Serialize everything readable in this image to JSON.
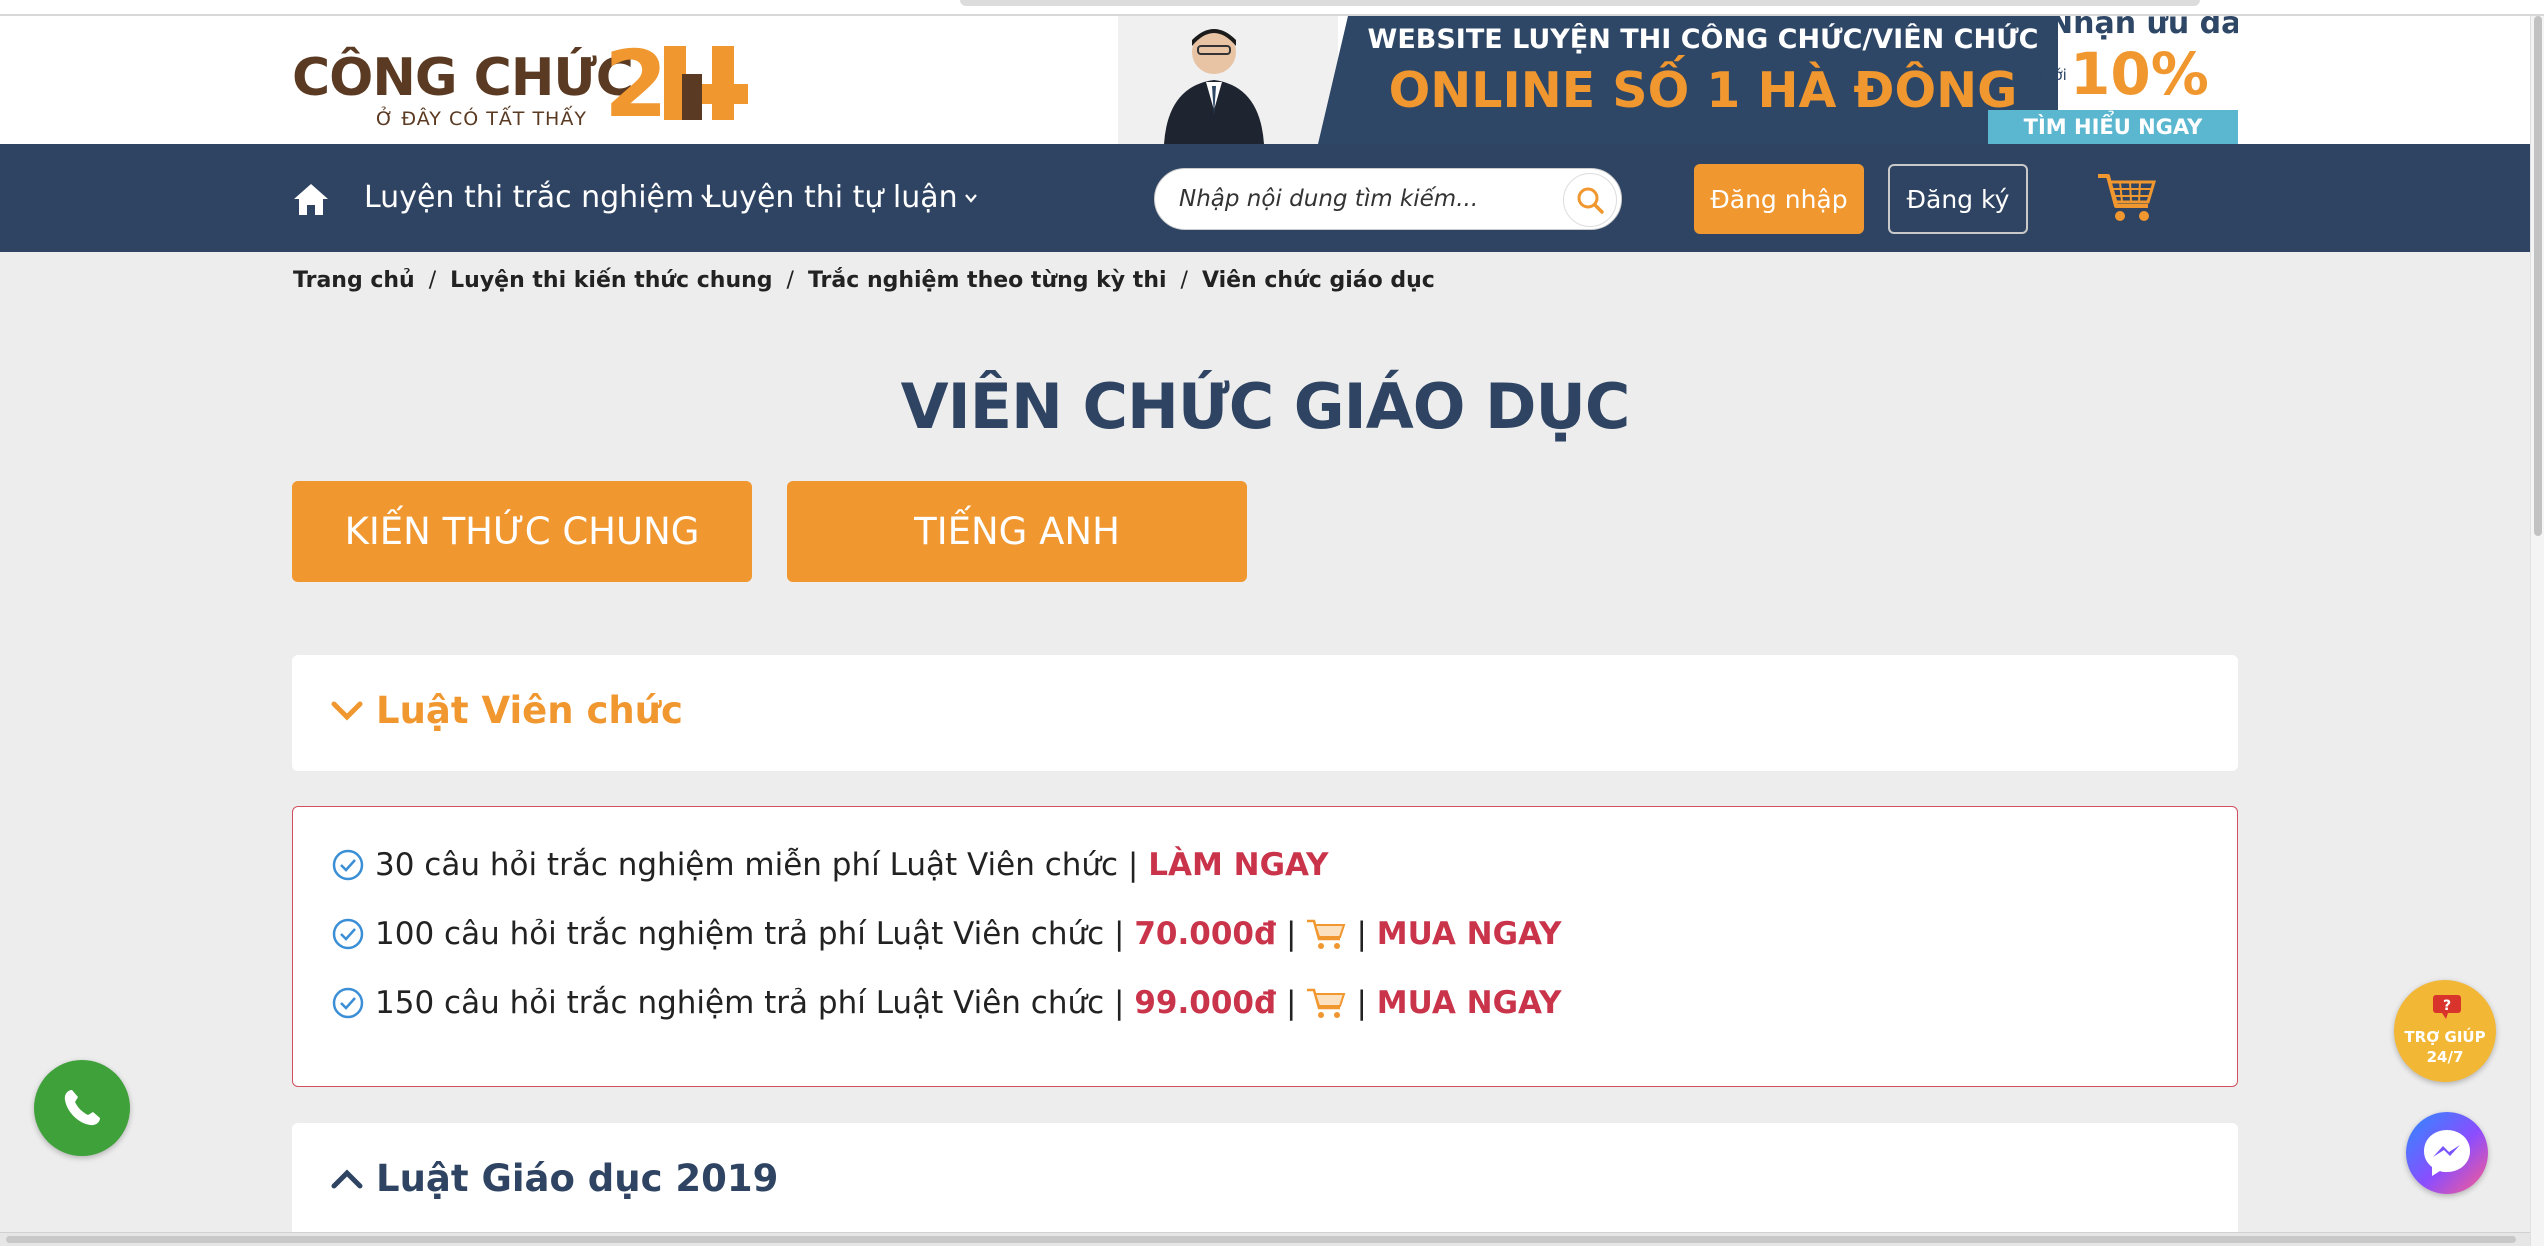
{
  "header": {
    "logo_text": "CÔNG CHỨC",
    "logo_number": "24",
    "logo_tagline": "Ở ĐÂY CÓ TẤT THẤY",
    "banner": {
      "line1": "WEBSITE LUYỆN THI CÔNG CHỨC/VIÊN CHỨC",
      "line2": "ONLINE SỐ 1 HÀ ĐÔNG",
      "offer": "Nhận ưu đãi",
      "upto": "Lên tới",
      "percent": "10%",
      "cta": "TÌM HIỂU NGAY"
    }
  },
  "nav": {
    "home_icon": "home-icon",
    "items": [
      {
        "label": "Luyện thi trắc nghiệm"
      },
      {
        "label": "Luyện thi tự luận"
      }
    ],
    "search_placeholder": "Nhập nội dung tìm kiếm...",
    "login_label": "Đăng nhập",
    "register_label": "Đăng ký",
    "cart_icon": "cart-icon"
  },
  "breadcrumb": [
    "Trang chủ",
    "Luyện thi kiến thức chung",
    "Trắc nghiệm theo từng kỳ thi",
    "Viên chức giáo dục"
  ],
  "page_title": "VIÊN CHỨC GIÁO DỤC",
  "tabs": [
    {
      "label": "KIẾN THỨC CHUNG"
    },
    {
      "label": "TIẾNG ANH"
    }
  ],
  "sections": [
    {
      "title": "Luật Viên chức",
      "expanded": true,
      "items": [
        {
          "text": "30 câu hỏi trắc nghiệm miễn phí Luật Viên chức |",
          "action": "LÀM NGAY"
        },
        {
          "text": "100 câu hỏi trắc nghiệm trả phí Luật Viên chức |",
          "price": "70.000đ",
          "sep": "|",
          "sep2": "|",
          "action": "MUA NGAY"
        },
        {
          "text": "150 câu hỏi trắc nghiệm trả phí Luật Viên chức |",
          "price": "99.000đ",
          "sep": "|",
          "sep2": "|",
          "action": "MUA NGAY"
        }
      ]
    },
    {
      "title": "Luật Giáo dục 2019",
      "expanded": false
    }
  ],
  "floating": {
    "help_line1": "TRỢ GIÚP",
    "help_line2": "24/7"
  },
  "colors": {
    "brand_orange": "#f0972f",
    "nav_blue": "#2e4462",
    "accent_red": "#c9344a",
    "check_blue": "#3b8fd6",
    "phone_green": "#3fa13a"
  }
}
